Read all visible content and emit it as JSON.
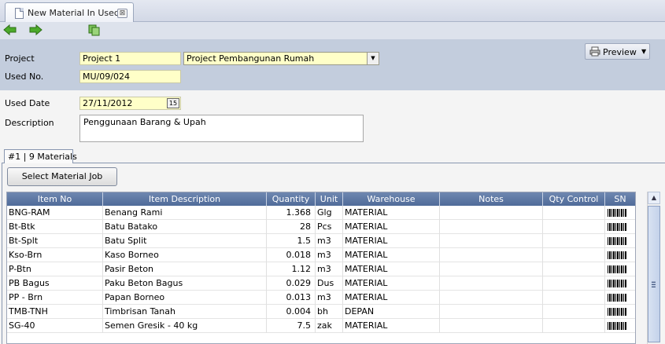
{
  "document_tab": {
    "title": "New Material In Used",
    "close": "⊠"
  },
  "toolbar": {
    "back_icon": "back-arrow-icon",
    "forward_icon": "forward-arrow-icon",
    "copy_icon": "copy-icon"
  },
  "header": {
    "project_label": "Project",
    "project_code": "Project 1",
    "project_name": "Project Pembangunan Rumah",
    "used_no_label": "Used No.",
    "used_no": "MU/09/024",
    "preview_label": "Preview"
  },
  "form": {
    "used_date_label": "Used Date",
    "used_date": "27/11/2012",
    "calendar_glyph": "15",
    "description_label": "Description",
    "description": "Penggunaan Barang & Upah"
  },
  "detail_tab": {
    "label": "#1 | 9 Materials"
  },
  "select_button": "Select Material Job",
  "table": {
    "columns": [
      "Item No",
      "Item Description",
      "Quantity",
      "Unit",
      "Warehouse",
      "Notes",
      "Qty Control",
      "SN"
    ],
    "rows": [
      {
        "item_no": "BNG-RAM",
        "desc": "Benang Rami",
        "qty": "1.368",
        "unit": "Glg",
        "warehouse": "MATERIAL",
        "notes": "",
        "qty_control": ""
      },
      {
        "item_no": "Bt-Btk",
        "desc": "Batu Batako",
        "qty": "28",
        "unit": "Pcs",
        "warehouse": "MATERIAL",
        "notes": "",
        "qty_control": ""
      },
      {
        "item_no": "Bt-Splt",
        "desc": "Batu Split",
        "qty": "1.5",
        "unit": "m3",
        "warehouse": "MATERIAL",
        "notes": "",
        "qty_control": ""
      },
      {
        "item_no": "Kso-Brn",
        "desc": "Kaso Borneo",
        "qty": "0.018",
        "unit": "m3",
        "warehouse": "MATERIAL",
        "notes": "",
        "qty_control": ""
      },
      {
        "item_no": "P-Btn",
        "desc": "Pasir Beton",
        "qty": "1.12",
        "unit": "m3",
        "warehouse": "MATERIAL",
        "notes": "",
        "qty_control": ""
      },
      {
        "item_no": "PB Bagus",
        "desc": "Paku Beton Bagus",
        "qty": "0.029",
        "unit": "Dus",
        "warehouse": "MATERIAL",
        "notes": "",
        "qty_control": ""
      },
      {
        "item_no": "PP - Brn",
        "desc": "Papan Borneo",
        "qty": "0.013",
        "unit": "m3",
        "warehouse": "MATERIAL",
        "notes": "",
        "qty_control": ""
      },
      {
        "item_no": "TMB-TNH",
        "desc": "Timbrisan Tanah",
        "qty": "0.004",
        "unit": "bh",
        "warehouse": "DEPAN",
        "notes": "",
        "qty_control": ""
      },
      {
        "item_no": "SG-40",
        "desc": "Semen Gresik - 40 kg",
        "qty": "7.5",
        "unit": "zak",
        "warehouse": "MATERIAL",
        "notes": "",
        "qty_control": ""
      }
    ]
  },
  "colors": {
    "header_band": "#c3cddd",
    "field_yellow": "#ffffc8",
    "grid_header": "#5a76a4"
  }
}
